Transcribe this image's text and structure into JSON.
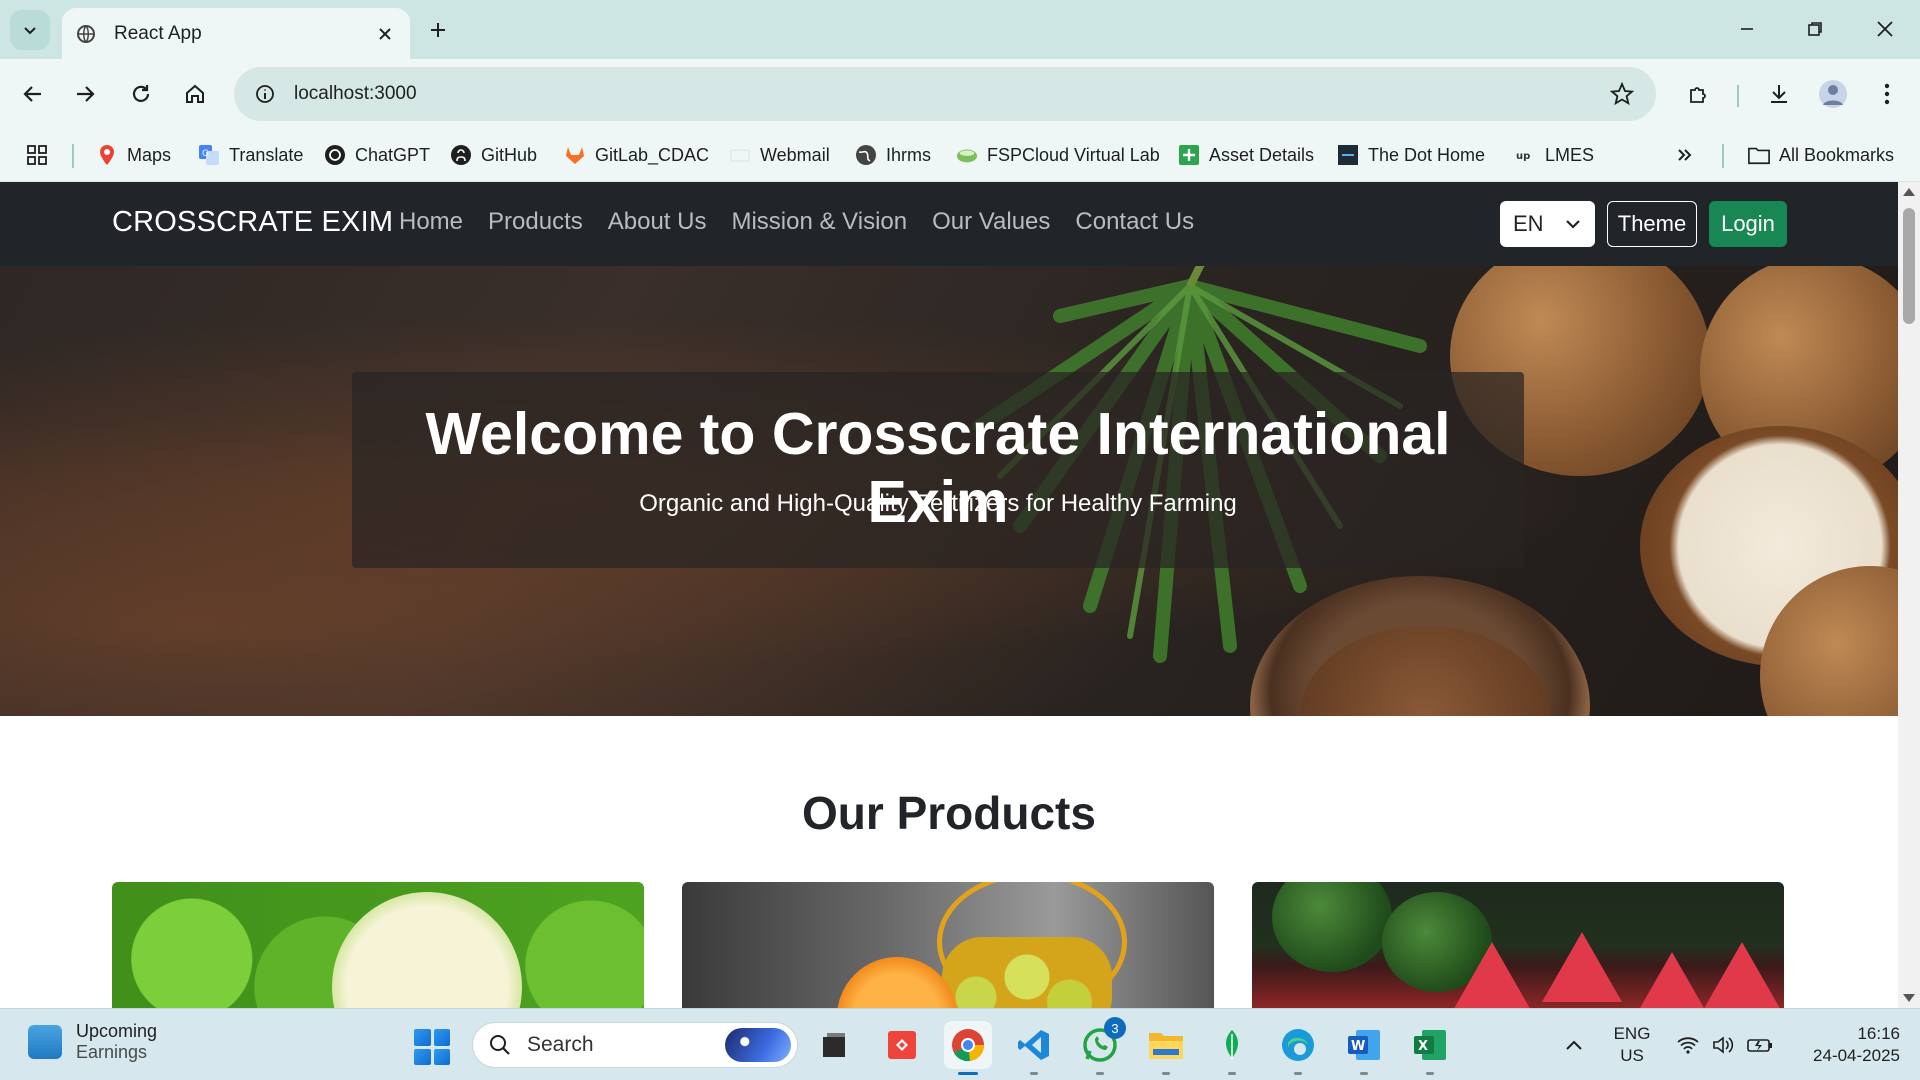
{
  "browser": {
    "tab_title": "React App",
    "url": "localhost:3000",
    "bookmarks": [
      {
        "label": "Maps",
        "icon": "maps-pin-icon"
      },
      {
        "label": "Translate",
        "icon": "translate-icon"
      },
      {
        "label": "ChatGPT",
        "icon": "chatgpt-icon"
      },
      {
        "label": "GitHub",
        "icon": "github-icon"
      },
      {
        "label": "GitLab_CDAC",
        "icon": "gitlab-icon"
      },
      {
        "label": "Webmail",
        "icon": "webmail-icon"
      },
      {
        "label": "Ihrms",
        "icon": "globe-icon"
      },
      {
        "label": "FSPCloud Virtual Lab",
        "icon": "fspcloud-icon"
      },
      {
        "label": "Asset Details",
        "icon": "asset-plus-icon"
      },
      {
        "label": "The Dot Home",
        "icon": "dot-home-icon"
      },
      {
        "label": "LMES",
        "icon": "lmes-icon"
      }
    ],
    "all_bookmarks_label": "All Bookmarks"
  },
  "site": {
    "brand": "CROSSCRATE EXIM",
    "nav": [
      "Home",
      "Products",
      "About Us",
      "Mission & Vision",
      "Our Values",
      "Contact Us"
    ],
    "language": "EN",
    "theme_label": "Theme",
    "login_label": "Login",
    "hero_title": "Welcome to Crosscrate International Exim",
    "hero_subtitle": "Organic and High-Quality Fertilizers for Healthy Farming",
    "products_heading": "Our Products",
    "colors": {
      "navbar": "#212529",
      "login": "#198754",
      "accent": "#0f6cbd"
    }
  },
  "taskbar": {
    "widget_line1": "Upcoming",
    "widget_line2": "Earnings",
    "search_placeholder": "Search",
    "whatsapp_badge": "3",
    "lang_line1": "ENG",
    "lang_line2": "US",
    "time": "16:16",
    "date": "24-04-2025"
  }
}
